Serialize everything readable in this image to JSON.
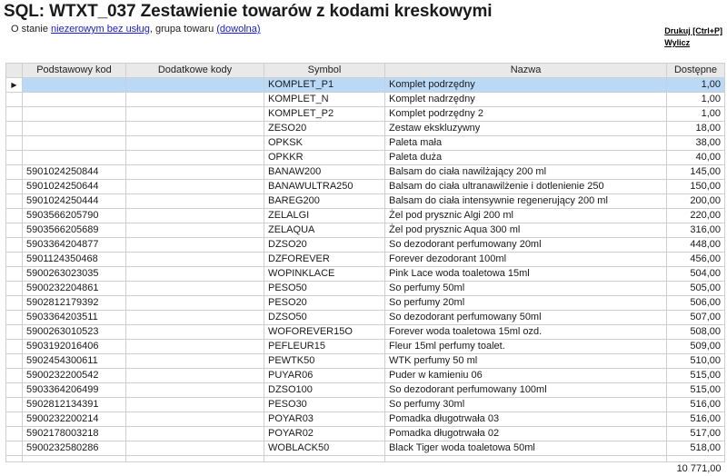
{
  "header": {
    "title": "SQL: WTXT_037 Zestawienie towarów z kodami kreskowymi",
    "subtitle_prefix": "O stanie ",
    "filter_stock_link": "niezerowym bez usług",
    "subtitle_middle": ", grupa towaru ",
    "filter_group_link": "(dowolna)"
  },
  "actions": {
    "print_label": "Drukuj [Ctrl+P]",
    "calc_label": "Wylicz"
  },
  "table": {
    "columns": [
      "Podstawowy kod",
      "Dodatkowe kody",
      "Symbol",
      "Nazwa",
      "Dostępne"
    ],
    "selected_marker": "▶",
    "rows": [
      {
        "kod": "",
        "dod": "",
        "symbol": "KOMPLET_P1",
        "nazwa": "Komplet podrzędny",
        "dost": "1,00"
      },
      {
        "kod": "",
        "dod": "",
        "symbol": "KOMPLET_N",
        "nazwa": "Komplet nadrzędny",
        "dost": "1,00"
      },
      {
        "kod": "",
        "dod": "",
        "symbol": "KOMPLET_P2",
        "nazwa": "Komplet podrzędny 2",
        "dost": "1,00"
      },
      {
        "kod": "",
        "dod": "",
        "symbol": "ZESO20",
        "nazwa": "Zestaw ekskluzywny",
        "dost": "18,00"
      },
      {
        "kod": "",
        "dod": "",
        "symbol": "OPKSK",
        "nazwa": "Paleta mała",
        "dost": "38,00"
      },
      {
        "kod": "",
        "dod": "",
        "symbol": "OPKKR",
        "nazwa": "Paleta duża",
        "dost": "40,00"
      },
      {
        "kod": "5901024250844",
        "dod": "",
        "symbol": "BANAW200",
        "nazwa": "Balsam do ciała nawilżający 200 ml",
        "dost": "145,00"
      },
      {
        "kod": "5901024250644",
        "dod": "",
        "symbol": "BANAWULTRA250",
        "nazwa": "Balsam do ciała ultranawilżenie i dotlenienie 250",
        "dost": "150,00"
      },
      {
        "kod": "5901024250444",
        "dod": "",
        "symbol": "BAREG200",
        "nazwa": "Balsam do ciała intensywnie regenerujący 200 ml",
        "dost": "200,00"
      },
      {
        "kod": "5903566205790",
        "dod": "",
        "symbol": "ZELALGI",
        "nazwa": "Żel pod prysznic Algi 200 ml",
        "dost": "220,00"
      },
      {
        "kod": "5903566205689",
        "dod": "",
        "symbol": "ZELAQUA",
        "nazwa": "Żel pod prysznic Aqua 300 ml",
        "dost": "316,00"
      },
      {
        "kod": "5903364204877",
        "dod": "",
        "symbol": "DZSO20",
        "nazwa": "So dezodorant perfumowany 20ml",
        "dost": "448,00"
      },
      {
        "kod": "5901124350468",
        "dod": "",
        "symbol": "DZFOREVER",
        "nazwa": "Forever dezodorant 100ml",
        "dost": "456,00"
      },
      {
        "kod": "5900263023035",
        "dod": "",
        "symbol": "WOPINKLACE",
        "nazwa": "Pink Lace woda toaletowa 15ml",
        "dost": "504,00"
      },
      {
        "kod": "5900232204861",
        "dod": "",
        "symbol": "PESO50",
        "nazwa": "So perfumy 50ml",
        "dost": "505,00"
      },
      {
        "kod": "5902812179392",
        "dod": "",
        "symbol": "PESO20",
        "nazwa": "So perfumy 20ml",
        "dost": "506,00"
      },
      {
        "kod": "5903364203511",
        "dod": "",
        "symbol": "DZSO50",
        "nazwa": "So dezodorant perfumowany 50ml",
        "dost": "507,00"
      },
      {
        "kod": "5900263010523",
        "dod": "",
        "symbol": "WOFOREVER15O",
        "nazwa": "Forever woda toaletowa 15ml ozd.",
        "dost": "508,00"
      },
      {
        "kod": "5903192016406",
        "dod": "",
        "symbol": "PEFLEUR15",
        "nazwa": "Fleur 15ml perfumy toalet.",
        "dost": "509,00"
      },
      {
        "kod": "5902454300611",
        "dod": "",
        "symbol": "PEWTK50",
        "nazwa": "WTK perfumy 50 ml",
        "dost": "510,00"
      },
      {
        "kod": "5900232200542",
        "dod": "",
        "symbol": "PUYAR06",
        "nazwa": "Puder w kamieniu 06",
        "dost": "515,00"
      },
      {
        "kod": "5903364206499",
        "dod": "",
        "symbol": "DZSO100",
        "nazwa": "So dezodorant perfumowany 100ml",
        "dost": "515,00"
      },
      {
        "kod": "5902812134391",
        "dod": "",
        "symbol": "PESO30",
        "nazwa": "So perfumy 30ml",
        "dost": "516,00"
      },
      {
        "kod": "5900232200214",
        "dod": "",
        "symbol": "POYAR03",
        "nazwa": "Pomadka długotrwała 03",
        "dost": "516,00"
      },
      {
        "kod": "5902178003218",
        "dod": "",
        "symbol": "POYAR02",
        "nazwa": "Pomadka długotrwała 02",
        "dost": "517,00"
      },
      {
        "kod": "5900232580286",
        "dod": "",
        "symbol": "WOBLACK50",
        "nazwa": "Black Tiger woda toaletowa 50ml",
        "dost": "518,00"
      }
    ],
    "total": "10 771,00"
  },
  "colors": {
    "selected_row": "#b9d9f7",
    "header_bg": "#e9e9e9",
    "link": "#1a1adc",
    "grid_border": "#cfcfcf"
  }
}
